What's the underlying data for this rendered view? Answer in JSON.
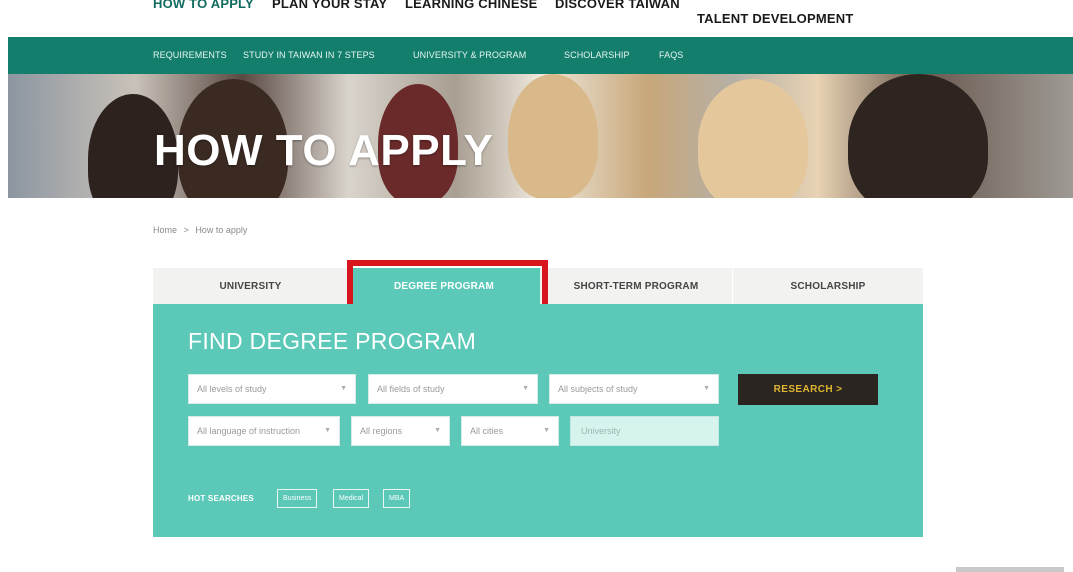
{
  "topnav": {
    "items": [
      "HOW TO APPLY",
      "PLAN YOUR STAY",
      "LEARNING CHINESE",
      "DISCOVER TAIWAN",
      "TALENT DEVELOPMENT"
    ]
  },
  "subnav": {
    "items": [
      "REQUIREMENTS",
      "STUDY IN TAIWAN IN 7 STEPS",
      "UNIVERSITY & PROGRAM",
      "SCHOLARSHIP",
      "FAQS"
    ]
  },
  "banner": {
    "title": "HOW TO APPLY"
  },
  "breadcrumb": {
    "home": "Home",
    "separator": ">",
    "current": "How to apply"
  },
  "tabs": [
    {
      "label": "UNIVERSITY"
    },
    {
      "label": "DEGREE PROGRAM"
    },
    {
      "label": "SHORT-TERM PROGRAM"
    },
    {
      "label": "SCHOLARSHIP"
    }
  ],
  "finder": {
    "heading": "FIND DEGREE PROGRAM",
    "selects": {
      "levels": "All levels of study",
      "fields": "All fields of study",
      "subjects": "All subjects of study",
      "language": "All language of instruction",
      "regions": "All regions",
      "cities": "All cities"
    },
    "university_placeholder": "University",
    "research_label": "RESEARCH  >",
    "hot_searches_label": "HOT SEARCHES",
    "hot_searches": [
      "Business",
      "Medical",
      "MBA"
    ]
  },
  "colors": {
    "subnav_bg": "#137e6c",
    "panel_bg": "#5bc8b8",
    "highlight": "#d8151c",
    "research_bg": "#2a2521",
    "research_text": "#e0b530"
  }
}
